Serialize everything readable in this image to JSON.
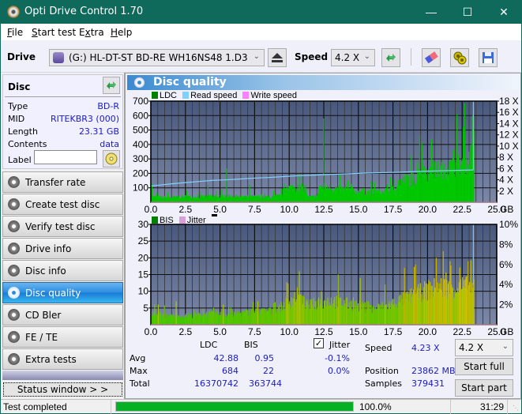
{
  "window": {
    "title": "Opti Drive Control 1.70",
    "controls": {
      "minimize": "—",
      "maximize": "☐",
      "close": "✕"
    }
  },
  "menu": {
    "items": [
      {
        "label": "File",
        "mnemonic": "F"
      },
      {
        "label": "Start test",
        "mnemonic": "S"
      },
      {
        "label": "Extra",
        "mnemonic": "x"
      },
      {
        "label": "Help",
        "mnemonic": "H"
      }
    ]
  },
  "toolbar": {
    "drive_label": "Drive",
    "drive_value": "(G:)  HL-DT-ST BD-RE  WH16NS48 1.D3",
    "speed_label": "Speed",
    "speed_value": "4.2 X",
    "icons": [
      "eject-icon",
      "refresh-icon",
      "erase-icon",
      "settings-icon",
      "save-icon"
    ]
  },
  "disc": {
    "header": "Disc",
    "rows": [
      {
        "key": "Type",
        "value": "BD-R"
      },
      {
        "key": "MID",
        "value": "RITEKBR3 (000)"
      },
      {
        "key": "Length",
        "value": "23.31 GB"
      },
      {
        "key": "Contents",
        "value": "data"
      }
    ],
    "label_key": "Label",
    "label_value": ""
  },
  "nav": {
    "items": [
      {
        "label": "Transfer rate",
        "active": false
      },
      {
        "label": "Create test disc",
        "active": false
      },
      {
        "label": "Verify test disc",
        "active": false
      },
      {
        "label": "Drive info",
        "active": false
      },
      {
        "label": "Disc info",
        "active": false
      },
      {
        "label": "Disc quality",
        "active": true
      },
      {
        "label": "CD Bler",
        "active": false
      },
      {
        "label": "FE / TE",
        "active": false
      },
      {
        "label": "Extra tests",
        "active": false
      }
    ],
    "status_window": "Status window > >"
  },
  "panel": {
    "title": "Disc quality"
  },
  "chart_data": [
    {
      "type": "bar",
      "title": "LDC",
      "legend": [
        {
          "name": "LDC",
          "color": "#008000"
        },
        {
          "name": "Read speed",
          "color": "#80d0ff"
        },
        {
          "name": "Write speed",
          "color": "#ff80ff"
        }
      ],
      "xlabel": "GB",
      "xlim": [
        0,
        25
      ],
      "xticks": [
        "0.0",
        "2.5",
        "5.0",
        "7.5",
        "10.0",
        "12.5",
        "15.0",
        "17.5",
        "20.0",
        "22.5",
        "25.0"
      ],
      "ylim": [
        0,
        700
      ],
      "yticks": [
        "100",
        "200",
        "300",
        "400",
        "500",
        "600",
        "700"
      ],
      "y2lim": [
        0,
        18
      ],
      "y2ticks": [
        "2 X",
        "4 X",
        "6 X",
        "8 X",
        "10 X",
        "12 X",
        "14 X",
        "16 X",
        "18 X"
      ],
      "grid": true,
      "ldc_profile": [
        [
          0.0,
          50
        ],
        [
          0.5,
          45
        ],
        [
          1.0,
          42
        ],
        [
          2.0,
          45
        ],
        [
          2.5,
          50
        ],
        [
          3.0,
          45
        ],
        [
          4.0,
          50
        ],
        [
          5.0,
          52
        ],
        [
          5.5,
          55
        ],
        [
          6.5,
          50
        ],
        [
          7.5,
          48
        ],
        [
          8.5,
          45
        ],
        [
          9.5,
          60
        ],
        [
          9.6,
          125
        ],
        [
          11.2,
          125
        ],
        [
          11.3,
          45
        ],
        [
          12.0,
          50
        ],
        [
          12.1,
          135
        ],
        [
          13.0,
          120
        ],
        [
          14.0,
          110
        ],
        [
          15.0,
          95
        ],
        [
          16.0,
          90
        ],
        [
          17.0,
          95
        ],
        [
          17.6,
          130
        ],
        [
          18.0,
          190
        ],
        [
          19.0,
          200
        ],
        [
          19.4,
          250
        ],
        [
          20.0,
          260
        ],
        [
          21.0,
          285
        ],
        [
          22.0,
          310
        ],
        [
          22.5,
          330
        ],
        [
          23.2,
          370
        ],
        [
          23.31,
          370
        ]
      ],
      "ldc_spikes": [
        [
          0.05,
          125
        ],
        [
          2.55,
          80
        ],
        [
          4.1,
          120
        ],
        [
          5.45,
          235
        ],
        [
          7.1,
          120
        ],
        [
          12.45,
          580
        ],
        [
          15.9,
          150
        ],
        [
          18.5,
          190
        ],
        [
          19.4,
          465
        ],
        [
          19.55,
          410
        ],
        [
          22.1,
          610
        ],
        [
          22.65,
          684
        ],
        [
          23.1,
          400
        ]
      ],
      "read_speed": [
        [
          0.0,
          2.9
        ],
        [
          0.8,
          3.1
        ],
        [
          1.6,
          3.3
        ],
        [
          2.5,
          3.5
        ],
        [
          3.5,
          3.7
        ],
        [
          4.5,
          3.9
        ],
        [
          5.5,
          4.0
        ],
        [
          6.5,
          4.15
        ],
        [
          7.5,
          4.3
        ],
        [
          8.5,
          4.4
        ],
        [
          9.5,
          4.55
        ],
        [
          10.5,
          4.7
        ],
        [
          11.5,
          4.8
        ],
        [
          12.5,
          4.9
        ],
        [
          13.5,
          5.0
        ],
        [
          14.5,
          5.1
        ],
        [
          15.5,
          5.2
        ],
        [
          17.0,
          5.3
        ],
        [
          18.0,
          5.35
        ],
        [
          19.5,
          5.5
        ],
        [
          21.0,
          5.6
        ],
        [
          22.5,
          5.7
        ],
        [
          23.31,
          5.75
        ]
      ],
      "end_marker_gb": 23.31
    },
    {
      "type": "bar",
      "title": "BIS",
      "legend": [
        {
          "name": "BIS",
          "color": "#008000"
        },
        {
          "name": "Jitter",
          "color": "#d8a0d8"
        }
      ],
      "xlabel": "GB",
      "xlim": [
        0,
        25
      ],
      "xticks": [
        "0.0",
        "2.5",
        "5.0",
        "7.5",
        "10.0",
        "12.5",
        "15.0",
        "17.5",
        "20.0",
        "22.5",
        "25.0"
      ],
      "ylim": [
        0,
        30
      ],
      "yticks": [
        "5",
        "10",
        "15",
        "20",
        "25",
        "30"
      ],
      "y2lim": [
        0,
        10
      ],
      "y2ticks": [
        "2%",
        "4%",
        "6%",
        "8%",
        "10%"
      ],
      "grid": true,
      "bis_profile": [
        [
          0.0,
          4
        ],
        [
          2.0,
          3
        ],
        [
          4.0,
          4
        ],
        [
          6.0,
          4
        ],
        [
          7.5,
          5
        ],
        [
          9.0,
          5
        ],
        [
          9.8,
          8
        ],
        [
          10.5,
          11
        ],
        [
          11.3,
          7
        ],
        [
          12.0,
          8
        ],
        [
          13.0,
          9
        ],
        [
          14.0,
          8
        ],
        [
          15.0,
          7
        ],
        [
          16.0,
          6
        ],
        [
          17.0,
          7
        ],
        [
          18.0,
          9
        ],
        [
          19.0,
          11
        ],
        [
          20.0,
          13
        ],
        [
          21.0,
          14
        ],
        [
          22.0,
          14
        ],
        [
          23.0,
          14
        ],
        [
          23.31,
          13
        ]
      ],
      "bis_spikes": [
        [
          0.5,
          6
        ],
        [
          1.8,
          7
        ],
        [
          5.2,
          6
        ],
        [
          7.7,
          7
        ],
        [
          10.7,
          16
        ],
        [
          12.3,
          10
        ],
        [
          13.5,
          15
        ],
        [
          15.1,
          14
        ],
        [
          16.9,
          12
        ],
        [
          18.3,
          17
        ],
        [
          19.1,
          18
        ],
        [
          20.6,
          20
        ],
        [
          21.1,
          22
        ],
        [
          21.6,
          19
        ],
        [
          22.9,
          19
        ]
      ],
      "end_marker_gb": 23.31
    }
  ],
  "stats": {
    "columns": [
      "LDC",
      "BIS"
    ],
    "rows": [
      {
        "label": "Avg",
        "ldc": "42.88",
        "bis": "0.95",
        "jitter": "-0.1%"
      },
      {
        "label": "Max",
        "ldc": "684",
        "bis": "22",
        "jitter": "0.0%"
      },
      {
        "label": "Total",
        "ldc": "16370742",
        "bis": "363744",
        "jitter": ""
      }
    ],
    "jitter_label": "Jitter",
    "jitter_checked": true,
    "speed_label": "Speed",
    "speed_value": "4.23 X",
    "position_label": "Position",
    "position_value": "23862 MB",
    "samples_label": "Samples",
    "samples_value": "379431",
    "speed_select": "4.2 X",
    "start_full": "Start full",
    "start_part": "Start part"
  },
  "status": {
    "text": "Test completed",
    "progress_percent": 100.0,
    "progress_label": "100.0%",
    "time": "31:29"
  }
}
